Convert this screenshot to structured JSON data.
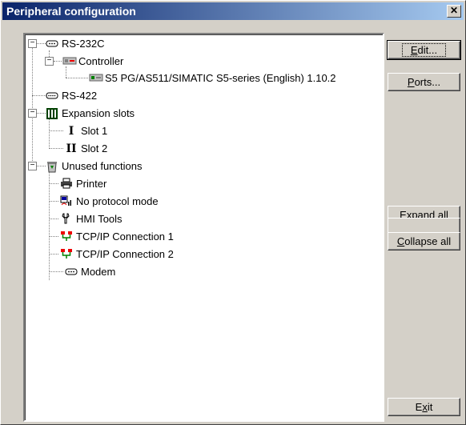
{
  "window": {
    "title": "Peripheral configuration",
    "close_glyph": "✕"
  },
  "tree": [
    {
      "label": "RS-232C",
      "icon": "serial-port-icon",
      "toggle": "−"
    },
    {
      "label": "Controller",
      "icon": "controller-icon",
      "toggle": "−"
    },
    {
      "label": "S5 PG/AS511/SIMATIC S5-series (English) 1.10.2",
      "icon": "plc-device-icon"
    },
    {
      "label": "RS-422",
      "icon": "serial-port-icon"
    },
    {
      "label": "Expansion slots",
      "icon": "expansion-slots-icon",
      "toggle": "−"
    },
    {
      "label": "Slot 1",
      "icon": "slot-1-icon"
    },
    {
      "label": "Slot 2",
      "icon": "slot-2-icon"
    },
    {
      "label": "Unused functions",
      "icon": "recycle-bin-icon",
      "toggle": "−"
    },
    {
      "label": "Printer",
      "icon": "printer-icon"
    },
    {
      "label": "No protocol mode",
      "icon": "no-protocol-icon"
    },
    {
      "label": "HMI Tools",
      "icon": "wrench-icon"
    },
    {
      "label": "TCP/IP Connection 1",
      "icon": "network-icon"
    },
    {
      "label": "TCP/IP Connection 2",
      "icon": "network-icon"
    },
    {
      "label": "Modem",
      "icon": "modem-icon"
    }
  ],
  "buttons": {
    "edit": {
      "mnemonic": "E",
      "rest": "dit..."
    },
    "ports": {
      "mnemonic": "P",
      "rest": "orts..."
    },
    "expand_all": {
      "mnemonic": "E",
      "rest": "xpand all"
    },
    "collapse_all": {
      "mnemonic": "C",
      "rest": "ollapse all"
    },
    "exit": {
      "pre": "E",
      "mnemonic": "x",
      "rest": "it"
    }
  }
}
